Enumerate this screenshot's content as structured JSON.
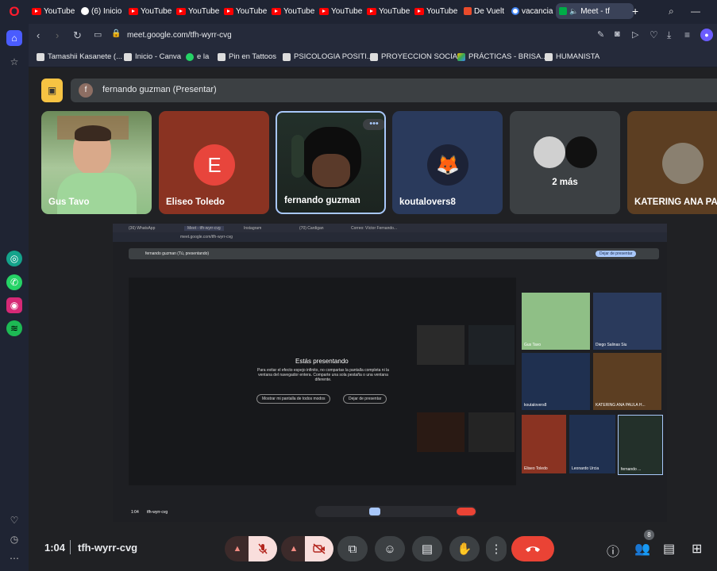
{
  "tabs": [
    {
      "label": "YouTube",
      "icon": "youtube-icon"
    },
    {
      "label": "(6) Inicio",
      "icon": "threads-icon"
    },
    {
      "label": "YouTube",
      "icon": "youtube-icon"
    },
    {
      "label": "YouTube",
      "icon": "youtube-icon"
    },
    {
      "label": "YouTube",
      "icon": "youtube-icon"
    },
    {
      "label": "YouTube",
      "icon": "youtube-icon"
    },
    {
      "label": "YouTube",
      "icon": "youtube-icon"
    },
    {
      "label": "YouTube",
      "icon": "youtube-icon"
    },
    {
      "label": "YouTube",
      "icon": "youtube-icon"
    },
    {
      "label": "De Vuelt",
      "icon": "red-site-icon"
    },
    {
      "label": "vacancia",
      "icon": "google-icon"
    },
    {
      "label": "Meet - tf",
      "icon": "meet-icon"
    }
  ],
  "address": {
    "url": "meet.google.com/tfh-wyrr-cvg"
  },
  "bookmarks": [
    {
      "label": "Tamashii Kasanete (..."
    },
    {
      "label": "Inicio - Canva"
    },
    {
      "label": "e la"
    },
    {
      "label": "Pin en Tattoos"
    },
    {
      "label": "PSICOLOGIA POSITI..."
    },
    {
      "label": "PROYECCION SOCIAL"
    },
    {
      "label": "PRÁCTICAS - BRISA..."
    },
    {
      "label": "HUMANISTA"
    }
  ],
  "presenter": {
    "initial": "f",
    "label": "fernando guzman (Presentar)"
  },
  "participants": [
    {
      "name": "Gus Tavo",
      "kind": "video"
    },
    {
      "name": "Eliseo Toledo",
      "kind": "initial",
      "initial": "E",
      "color": "#e8453c"
    },
    {
      "name": "fernando guzman",
      "kind": "video"
    },
    {
      "name": "koutalovers8",
      "kind": "avatar"
    },
    {
      "name": "2 más",
      "kind": "group"
    },
    {
      "name": "KATERING ANA PA...",
      "kind": "avatar"
    }
  ],
  "shared": {
    "tabs": [
      "(36) WhatsApp",
      "Meet - tfh-wyrr-cvg",
      "Instagram",
      "(70) Cardigan",
      "Correo: Víctor Fernando..."
    ],
    "url": "meet.google.com/tfh-wyrr-cvg",
    "presenting_label": "fernando guzman (Tú, presentando)",
    "stop_button": "Dejar de presentar",
    "dialog_title": "Estás presentando",
    "dialog_body": "Para evitar el efecto espejo infinito, no compartas la pantalla completa ni la ventana del navegador entera. Comparte una sola pestaña o una ventana diferente.",
    "dialog_btn1": "Mostrar mi pantalla de todos modos",
    "dialog_btn2": "Dejar de presentar",
    "tiles": [
      "Gus Tavo",
      "Diego Salinas Siu",
      "koutalovers8",
      "KATERING ANA PAULA H...",
      "Eliseo Toledo",
      "Leonardo Urcia",
      "fernando ..."
    ],
    "time": "1:04",
    "code": "tfh-wyrr-cvg"
  },
  "meeting": {
    "time": "1:04",
    "code": "tfh-wyrr-cvg",
    "people_count": "8"
  },
  "colors": {
    "leave": "#ea4335",
    "present_yellow": "#f6c343",
    "mic_off_bg": "#f9dedc"
  }
}
